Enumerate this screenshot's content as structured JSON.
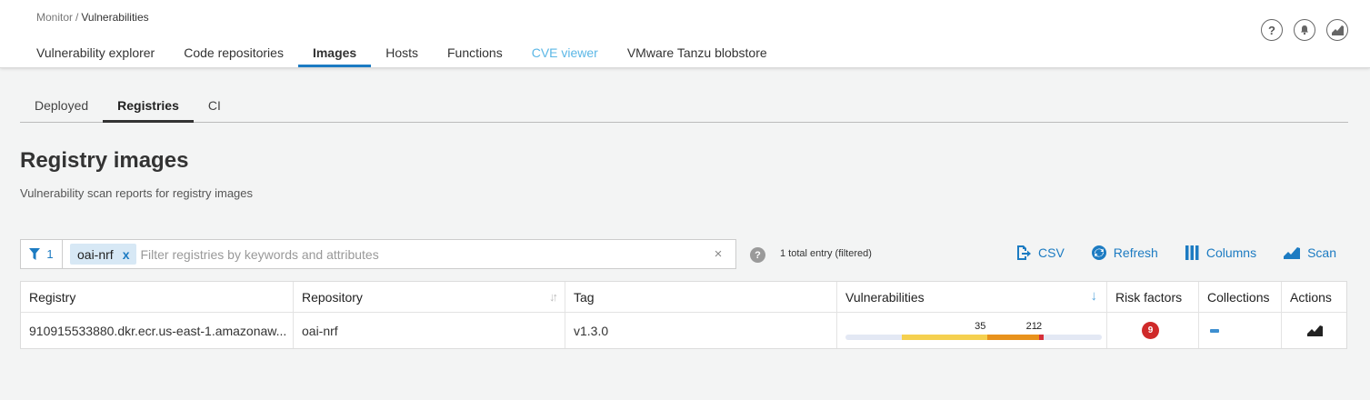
{
  "breadcrumb": {
    "root": "Monitor",
    "separator": "/",
    "current": "Vulnerabilities"
  },
  "main_tabs": [
    {
      "label": "Vulnerability explorer"
    },
    {
      "label": "Code repositories"
    },
    {
      "label": "Images",
      "active": true
    },
    {
      "label": "Hosts"
    },
    {
      "label": "Functions"
    },
    {
      "label": "CVE viewer",
      "link": true
    },
    {
      "label": "VMware Tanzu blobstore"
    }
  ],
  "top_icons": [
    "help-icon",
    "notifications-icon",
    "radar-icon"
  ],
  "sub_tabs": [
    {
      "label": "Deployed"
    },
    {
      "label": "Registries",
      "active": true
    },
    {
      "label": "CI"
    }
  ],
  "page": {
    "title": "Registry images",
    "subtitle": "Vulnerability scan reports for registry images"
  },
  "filter": {
    "count": "1",
    "chip": "oai-nrf",
    "chip_close": "x",
    "placeholder": "Filter registries by keywords and attributes",
    "clear": "×",
    "value": ""
  },
  "help": "?",
  "total_entry": "1 total entry (filtered)",
  "actions": {
    "csv": "CSV",
    "refresh": "Refresh",
    "columns": "Columns",
    "scan": "Scan"
  },
  "table": {
    "headers": {
      "registry": "Registry",
      "repository": "Repository",
      "tag": "Tag",
      "vulnerabilities": "Vulnerabilities",
      "risk_factors": "Risk factors",
      "collections": "Collections",
      "actions": "Actions"
    },
    "rows": [
      {
        "registry": "910915533880.dkr.ecr.us-east-1.amazonaw...",
        "repository": "oai-nrf",
        "tag": "v1.3.0",
        "vulnerabilities": {
          "medium": "35",
          "high": "21",
          "critical": "2"
        },
        "risk_factors": "9"
      }
    ]
  },
  "colors": {
    "accent": "#1c7bc2",
    "medium": "#f5d04f",
    "high": "#e8921c",
    "critical": "#d6303a",
    "risk_badge": "#cf2a2a"
  }
}
